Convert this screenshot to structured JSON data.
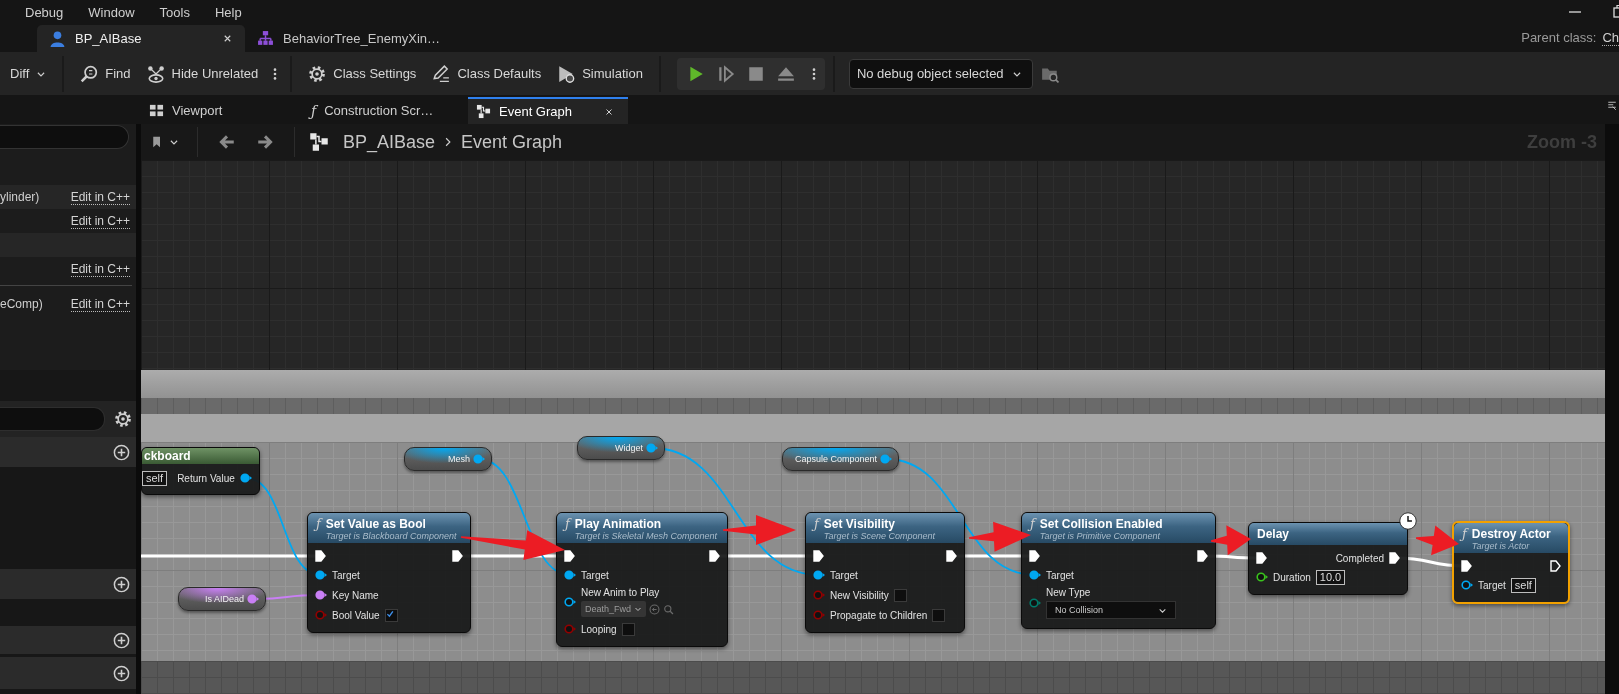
{
  "menu_bar": {
    "items": [
      "Debug",
      "Window",
      "Tools",
      "Help"
    ]
  },
  "document_tabs": [
    {
      "label": "BP_AIBase",
      "kind": "blueprint",
      "selected": true,
      "closable": true
    },
    {
      "label": "BehaviorTree_EnemyXin…",
      "kind": "behavior_tree",
      "selected": false,
      "closable": false
    }
  ],
  "parent_class": {
    "label": "Parent class:",
    "value": "Ch"
  },
  "toolbar": {
    "buttons": [
      {
        "label": "Diff",
        "dropdown": true
      },
      {
        "label": "Find",
        "dropdown": false
      },
      {
        "label": "Hide Unrelated",
        "dropdown": false
      },
      {
        "label": "Class Settings",
        "dropdown": false
      },
      {
        "label": "Class Defaults",
        "dropdown": false
      },
      {
        "label": "Simulation",
        "dropdown": false
      }
    ],
    "play_controls": [
      {
        "disabled": false
      },
      {
        "disabled": true
      },
      {
        "disabled": true
      },
      {
        "disabled": true
      }
    ],
    "debug_object": {
      "value": "No debug object selected"
    }
  },
  "graph_tabs": [
    {
      "label": "Viewport",
      "kind": "viewport",
      "selected": false,
      "closable": false
    },
    {
      "label": "Construction Scr…",
      "kind": "function",
      "glyph": "ƒ",
      "selected": false,
      "closable": false
    },
    {
      "label": "Event Graph",
      "kind": "graph",
      "selected": true,
      "closable": true
    }
  ],
  "components_panel": {
    "rows": [
      {
        "kind": "component",
        "label": "ylinder)",
        "link": "Edit in C++"
      },
      {
        "kind": "component",
        "link": "Edit in C++"
      },
      {
        "kind": "spacer"
      },
      {
        "kind": "component",
        "link": "Edit in C++"
      },
      {
        "kind": "component",
        "label": "eComp)",
        "link": "Edit in C++"
      }
    ]
  },
  "breadcrumb": {
    "items": [
      "BP_AIBase",
      "Event Graph"
    ]
  },
  "zoom_label": "Zoom -3",
  "graph": {
    "nodes": [
      {
        "kind": "pure",
        "title": "ckboard",
        "selected": false,
        "rows": [
          {
            "left": {
              "editor": {
                "kind": "text",
                "value": "self"
              }
            },
            "right": {
              "name": "Return Value",
              "kind": "object",
              "linked": true
            }
          }
        ]
      },
      {
        "kind": "variable",
        "selected": false,
        "rows": [
          {
            "right": {
              "name": "Mesh",
              "kind": "object",
              "linked": true
            }
          }
        ]
      },
      {
        "kind": "variable",
        "selected": false,
        "rows": [
          {
            "right": {
              "name": "Widget",
              "kind": "object",
              "linked": true
            }
          }
        ]
      },
      {
        "kind": "variable",
        "selected": false,
        "rows": [
          {
            "right": {
              "name": "Capsule Component",
              "kind": "object",
              "linked": true
            }
          }
        ]
      },
      {
        "kind": "variable",
        "selected": false,
        "rows": [
          {
            "right": {
              "name": "Is AIDead",
              "kind": "name",
              "linked": true
            }
          }
        ]
      },
      {
        "kind": "function",
        "glyph": "ƒ",
        "title": "Set Value as Bool",
        "subtitle": "Target is Blackboard Component",
        "selected": false,
        "rows": [
          {
            "left": {
              "kind": "exec",
              "linked": true
            },
            "right": {
              "kind": "exec",
              "linked": true
            }
          },
          {
            "left": {
              "name": "Target",
              "kind": "object",
              "linked": true
            }
          },
          {
            "left": {
              "name": "Key Name",
              "kind": "name",
              "linked": true
            }
          },
          {
            "left": {
              "name": "Bool Value",
              "kind": "bool",
              "linked": false,
              "editor": {
                "kind": "checkbox",
                "checked": true
              }
            }
          }
        ]
      },
      {
        "kind": "function",
        "glyph": "ƒ",
        "title": "Play Animation",
        "subtitle": "Target is Skeletal Mesh Component",
        "selected": false,
        "rows": [
          {
            "left": {
              "kind": "exec",
              "linked": true
            },
            "right": {
              "kind": "exec",
              "linked": true
            }
          },
          {
            "left": {
              "name": "Target",
              "kind": "object",
              "linked": true
            }
          },
          {
            "left": {
              "name": "New Anim to Play",
              "kind": "asset",
              "linked": false,
              "editor": {
                "kind": "asset",
                "value": "Death_Fwd"
              }
            }
          },
          {
            "left": {
              "name": "Looping",
              "kind": "bool",
              "linked": false,
              "editor": {
                "kind": "checkbox",
                "checked": false
              }
            }
          }
        ]
      },
      {
        "kind": "function",
        "glyph": "ƒ",
        "title": "Set Visibility",
        "subtitle": "Target is Scene Component",
        "selected": false,
        "rows": [
          {
            "left": {
              "kind": "exec",
              "linked": true
            },
            "right": {
              "kind": "exec",
              "linked": true
            }
          },
          {
            "left": {
              "name": "Target",
              "kind": "object",
              "linked": true
            }
          },
          {
            "left": {
              "name": "New Visibility",
              "kind": "bool",
              "linked": false,
              "editor": {
                "kind": "checkbox",
                "checked": false
              }
            }
          },
          {
            "left": {
              "name": "Propagate to Children",
              "kind": "bool",
              "linked": false,
              "editor": {
                "kind": "checkbox",
                "checked": false
              }
            }
          }
        ]
      },
      {
        "kind": "function",
        "glyph": "ƒ",
        "title": "Set Collision Enabled",
        "subtitle": "Target is Primitive Component",
        "selected": false,
        "rows": [
          {
            "left": {
              "kind": "exec",
              "linked": true
            },
            "right": {
              "kind": "exec",
              "linked": true
            }
          },
          {
            "left": {
              "name": "Target",
              "kind": "object",
              "linked": true
            }
          },
          {
            "left": {
              "name": "New Type",
              "kind": "enum",
              "linked": false,
              "editor": {
                "kind": "dropdown",
                "value": "No Collision"
              }
            }
          }
        ]
      },
      {
        "kind": "latent",
        "title": "Delay",
        "selected": false,
        "rows": [
          {
            "left": {
              "kind": "exec",
              "linked": true
            },
            "right": {
              "name": "Completed",
              "kind": "exec",
              "linked": true
            }
          },
          {
            "left": {
              "name": "Duration",
              "kind": "float",
              "linked": false,
              "editor": {
                "kind": "text",
                "value": "10.0"
              }
            }
          }
        ]
      },
      {
        "kind": "function",
        "glyph": "ƒ",
        "title": "Destroy Actor",
        "subtitle": "Target is Actor",
        "selected": true,
        "rows": [
          {
            "left": {
              "kind": "exec",
              "linked": true
            },
            "right": {
              "kind": "exec",
              "linked": false
            }
          },
          {
            "left": {
              "name": "Target",
              "kind": "object",
              "linked": false,
              "editor": {
                "kind": "text",
                "value": "self"
              }
            }
          }
        ]
      }
    ]
  }
}
